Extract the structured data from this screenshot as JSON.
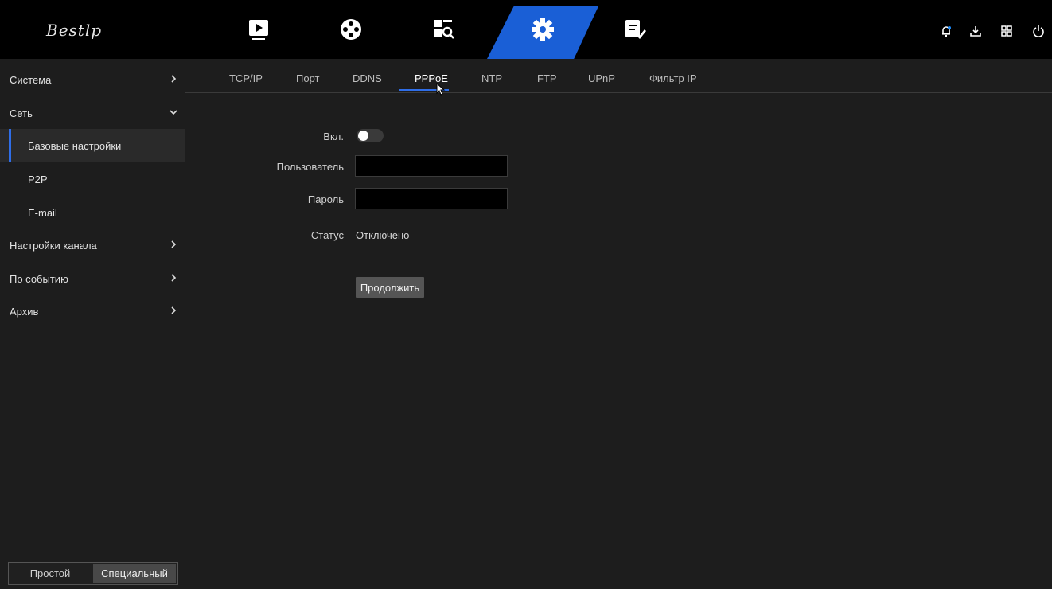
{
  "app": {
    "logo_text": "Bestlp"
  },
  "top_nav": {
    "icons": [
      "playback-icon",
      "record-icon",
      "search-icon",
      "settings-icon",
      "maintenance-icon"
    ],
    "active": "settings-icon",
    "accent_color": "#1a5fd6",
    "right_icons": [
      "alarm-icon",
      "download-icon",
      "layout-icon",
      "power-icon"
    ]
  },
  "sidebar": {
    "items": [
      {
        "label": "Система",
        "arrow": "right"
      },
      {
        "label": "Сеть",
        "arrow": "down"
      },
      {
        "label": "Базовые настройки",
        "selected": true
      },
      {
        "label": "P2P"
      },
      {
        "label": "E-mail"
      },
      {
        "label": "Настройки канала",
        "arrow": "right"
      },
      {
        "label": "По событию",
        "arrow": "right"
      },
      {
        "label": "Архив",
        "arrow": "right"
      }
    ],
    "mode": {
      "simple": "Простой",
      "advanced": "Специальный",
      "active": "advanced"
    }
  },
  "tabs": [
    {
      "label": "TCP/IP"
    },
    {
      "label": "Порт"
    },
    {
      "label": "DDNS"
    },
    {
      "label": "PPPoE",
      "active": true
    },
    {
      "label": "NTP"
    },
    {
      "label": "FTP"
    },
    {
      "label": "UPnP"
    },
    {
      "label": "Фильтр IP"
    }
  ],
  "form": {
    "enable_label": "Вкл.",
    "enable_value": false,
    "user_label": "Пользователь",
    "user_value": "",
    "password_label": "Пароль",
    "password_value": "",
    "status_label": "Статус",
    "status_value": "Отключено",
    "continue_label": "Продолжить"
  }
}
